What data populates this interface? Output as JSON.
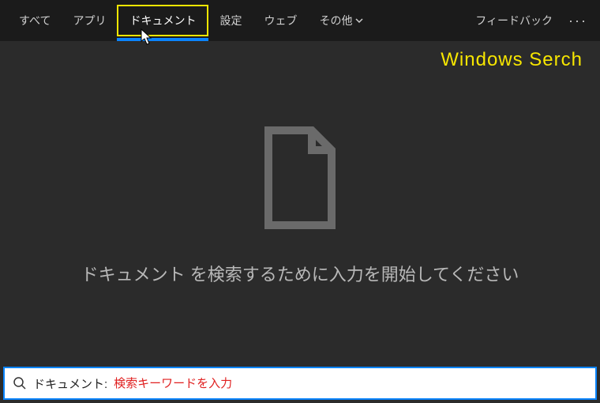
{
  "topbar": {
    "tabs": [
      {
        "label": "すべて"
      },
      {
        "label": "アプリ"
      },
      {
        "label": "ドキュメント"
      },
      {
        "label": "設定"
      },
      {
        "label": "ウェブ"
      },
      {
        "label": "その他"
      }
    ],
    "active_index": 2,
    "feedback_label": "フィードバック"
  },
  "banner": "Windows Serch",
  "main": {
    "prompt": "ドキュメント を検索するために入力を開始してください"
  },
  "search": {
    "scope_label": "ドキュメント:",
    "placeholder": "検索キーワードを入力",
    "value": ""
  }
}
